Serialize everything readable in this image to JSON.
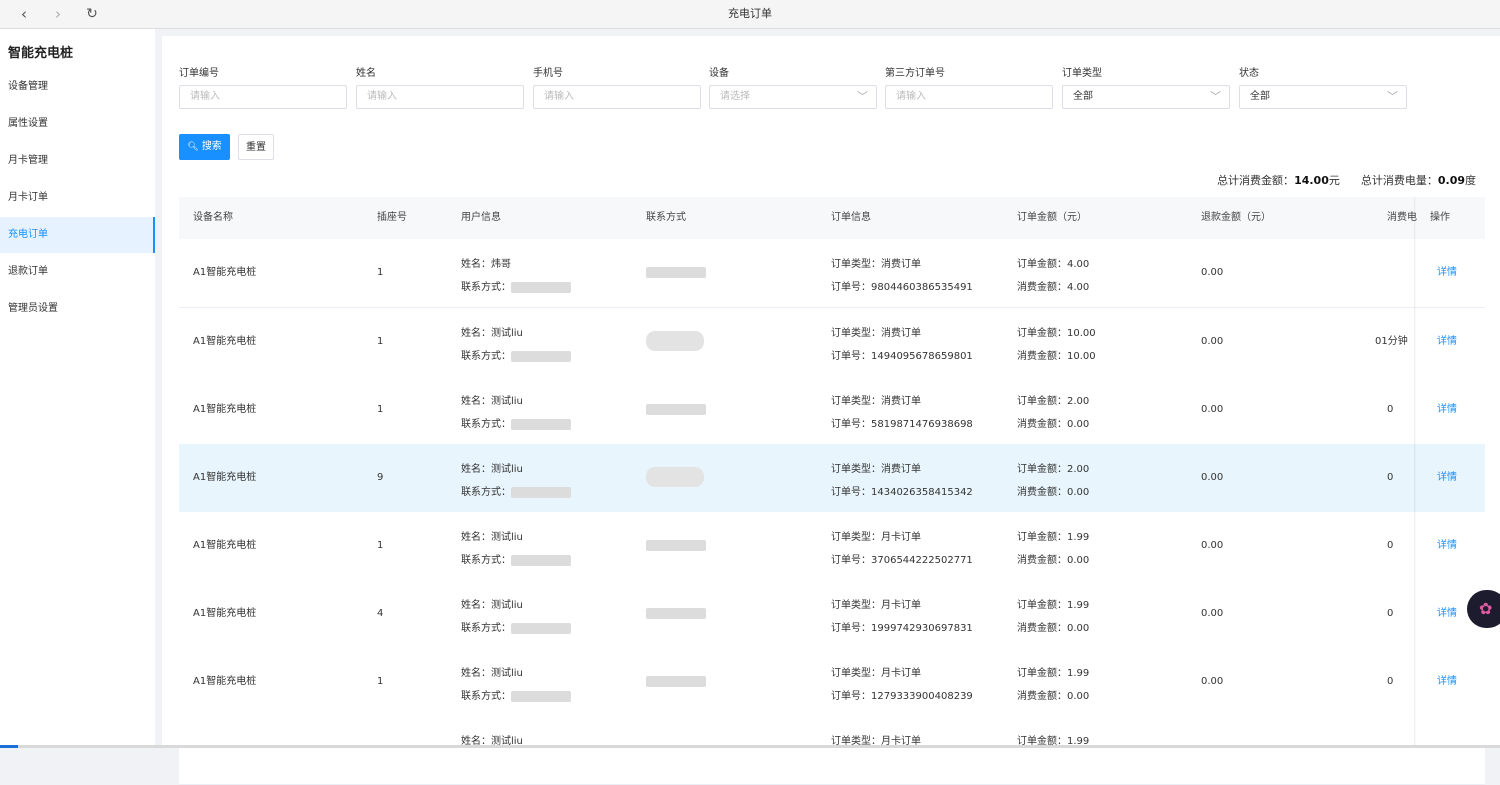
{
  "topbar": {
    "back": "‹",
    "forward": "›",
    "refresh": "↻",
    "title": "充电订单"
  },
  "sidebar": {
    "title": "智能充电桩",
    "items": [
      {
        "label": "设备管理"
      },
      {
        "label": "属性设置"
      },
      {
        "label": "月卡管理"
      },
      {
        "label": "月卡订单"
      },
      {
        "label": "充电订单"
      },
      {
        "label": "退款订单"
      },
      {
        "label": "管理员设置"
      }
    ]
  },
  "filters": {
    "order_no": {
      "label": "订单编号",
      "placeholder": "请输入"
    },
    "name": {
      "label": "姓名",
      "placeholder": "请输入"
    },
    "phone": {
      "label": "手机号",
      "placeholder": "请输入"
    },
    "device": {
      "label": "设备",
      "placeholder": "请选择"
    },
    "third_order": {
      "label": "第三方订单号",
      "placeholder": "请输入"
    },
    "order_type": {
      "label": "订单类型",
      "value": "全部"
    },
    "status": {
      "label": "状态",
      "value": "全部"
    }
  },
  "buttons": {
    "search": "搜索",
    "reset": "重置"
  },
  "summary": {
    "amount_label": "总计消费金额：",
    "amount_value": "14.00",
    "amount_unit": "元",
    "energy_label": "总计消费电量：",
    "energy_value": "0.09",
    "energy_unit": "度"
  },
  "table": {
    "headers": [
      "设备名称",
      "插座号",
      "用户信息",
      "联系方式",
      "订单信息",
      "订单金额（元）",
      "退款金额（元）",
      "消费电",
      "操作"
    ],
    "rows": [
      {
        "device": "A1智能充电桩",
        "socket": "1",
        "name": "姓名：炜哥",
        "contact": "联系方式：",
        "order_type": "订单类型：消费订单",
        "order_no": "订单号：9804460386535491",
        "order_amount": "订单金额：4.00",
        "consume_amount": "消费金额：4.00",
        "refund": "0.00",
        "energy": "",
        "action": "详情"
      },
      {
        "device": "A1智能充电桩",
        "socket": "1",
        "name": "姓名：测试liu",
        "contact": "联系方式：",
        "order_type": "订单类型：消费订单",
        "order_no": "订单号：1494095678659801",
        "order_amount": "订单金额：10.00",
        "consume_amount": "消费金额：10.00",
        "refund": "0.00",
        "energy": "01分钟",
        "action": "详情"
      },
      {
        "device": "A1智能充电桩",
        "socket": "1",
        "name": "姓名：测试liu",
        "contact": "联系方式：",
        "order_type": "订单类型：消费订单",
        "order_no": "订单号：5819871476938698",
        "order_amount": "订单金额：2.00",
        "consume_amount": "消费金额：0.00",
        "refund": "0.00",
        "energy": "0",
        "action": "详情"
      },
      {
        "device": "A1智能充电桩",
        "socket": "9",
        "name": "姓名：测试liu",
        "contact": "联系方式：",
        "order_type": "订单类型：消费订单",
        "order_no": "订单号：1434026358415342",
        "order_amount": "订单金额：2.00",
        "consume_amount": "消费金额：0.00",
        "refund": "0.00",
        "energy": "0",
        "action": "详情"
      },
      {
        "device": "A1智能充电桩",
        "socket": "1",
        "name": "姓名：测试liu",
        "contact": "联系方式：",
        "order_type": "订单类型：月卡订单",
        "order_no": "订单号：3706544222502771",
        "order_amount": "订单金额：1.99",
        "consume_amount": "消费金额：0.00",
        "refund": "0.00",
        "energy": "0",
        "action": "详情"
      },
      {
        "device": "A1智能充电桩",
        "socket": "4",
        "name": "姓名：测试liu",
        "contact": "联系方式：",
        "order_type": "订单类型：月卡订单",
        "order_no": "订单号：1999742930697831",
        "order_amount": "订单金额：1.99",
        "consume_amount": "消费金额：0.00",
        "refund": "0.00",
        "energy": "0",
        "action": "详情"
      },
      {
        "device": "A1智能充电桩",
        "socket": "1",
        "name": "姓名：测试liu",
        "contact": "联系方式：",
        "order_type": "订单类型：月卡订单",
        "order_no": "订单号：1279333900408239",
        "order_amount": "订单金额：1.99",
        "consume_amount": "消费金额：0.00",
        "refund": "0.00",
        "energy": "0",
        "action": "详情"
      },
      {
        "device": "",
        "socket": "",
        "name": "姓名：测试liu",
        "contact": "",
        "order_type": "订单类型：月卡订单",
        "order_no": "",
        "order_amount": "订单金额：1.99",
        "consume_amount": "",
        "refund": "",
        "energy": "",
        "action": ""
      }
    ]
  }
}
